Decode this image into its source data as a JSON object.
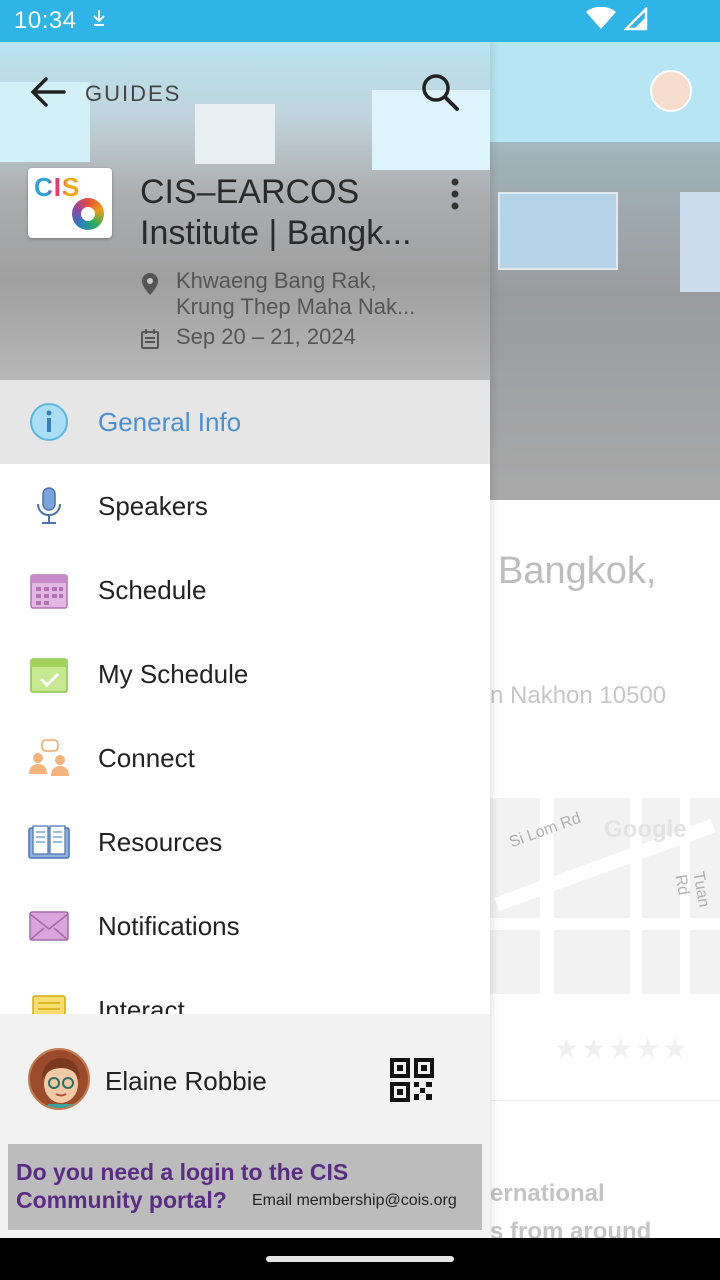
{
  "status_bar": {
    "time": "10:34",
    "download_icon": "download-arrow-icon",
    "wifi_icon": "wifi-icon",
    "signal_icon": "cell-signal-icon"
  },
  "background_screen": {
    "title_fragment": "Bangkok,",
    "address_fragment": "n Nakhon 10500",
    "map_roads": [
      "Si Lom Rd",
      "Tuan Rd"
    ],
    "map_logo": "Google",
    "rating_stars": "★★★★★",
    "text_line_1": "ernational",
    "text_line_2": "s from around"
  },
  "drawer": {
    "header": {
      "back_icon": "arrow-back-icon",
      "guides_label": "GUIDES",
      "search_icon": "search-icon",
      "logo_text": "CIS",
      "title_line_1": "CIS–EARCOS",
      "title_line_2": "Institute | Bangk...",
      "more_icon": "more-vertical-icon",
      "location_line_1": "Khwaeng Bang Rak,",
      "location_line_2": "Krung Thep Maha Nak...",
      "dates": "Sep 20 – 21, 2024"
    },
    "menu": [
      {
        "label": "General Info",
        "icon": "info-icon",
        "active": true
      },
      {
        "label": "Speakers",
        "icon": "microphone-icon",
        "active": false
      },
      {
        "label": "Schedule",
        "icon": "calendar-icon",
        "active": false
      },
      {
        "label": "My Schedule",
        "icon": "calendar-check-icon",
        "active": false
      },
      {
        "label": "Connect",
        "icon": "people-chat-icon",
        "active": false
      },
      {
        "label": "Resources",
        "icon": "open-book-icon",
        "active": false
      },
      {
        "label": "Notifications",
        "icon": "envelope-icon",
        "active": false
      },
      {
        "label": "Interact",
        "icon": "note-icon",
        "active": false
      }
    ],
    "footer": {
      "user_name": "Elaine Robbie",
      "qr_icon": "qr-code-icon",
      "banner_line_1": "Do you need a login to the CIS",
      "banner_line_2": "Community portal?",
      "banner_email": "Email membership@cois.org"
    }
  },
  "colors": {
    "status_bar": "#2eb4e6",
    "active_label": "#4a8fd0",
    "active_row": "#e6e6e6",
    "banner_text": "#5b2c83"
  }
}
